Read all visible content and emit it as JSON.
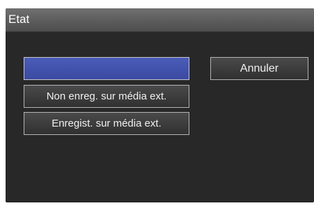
{
  "dialog": {
    "title": "Etat",
    "options": [
      {
        "label": "",
        "selected": true
      },
      {
        "label": "Non enreg. sur média ext.",
        "selected": false
      },
      {
        "label": "Enregist. sur média ext.",
        "selected": false
      }
    ],
    "cancel_label": "Annuler"
  },
  "colors": {
    "background": "#282828",
    "titlebar": "#5e5e5e",
    "selected": "#4152ad",
    "border": "#b4b4b4"
  }
}
